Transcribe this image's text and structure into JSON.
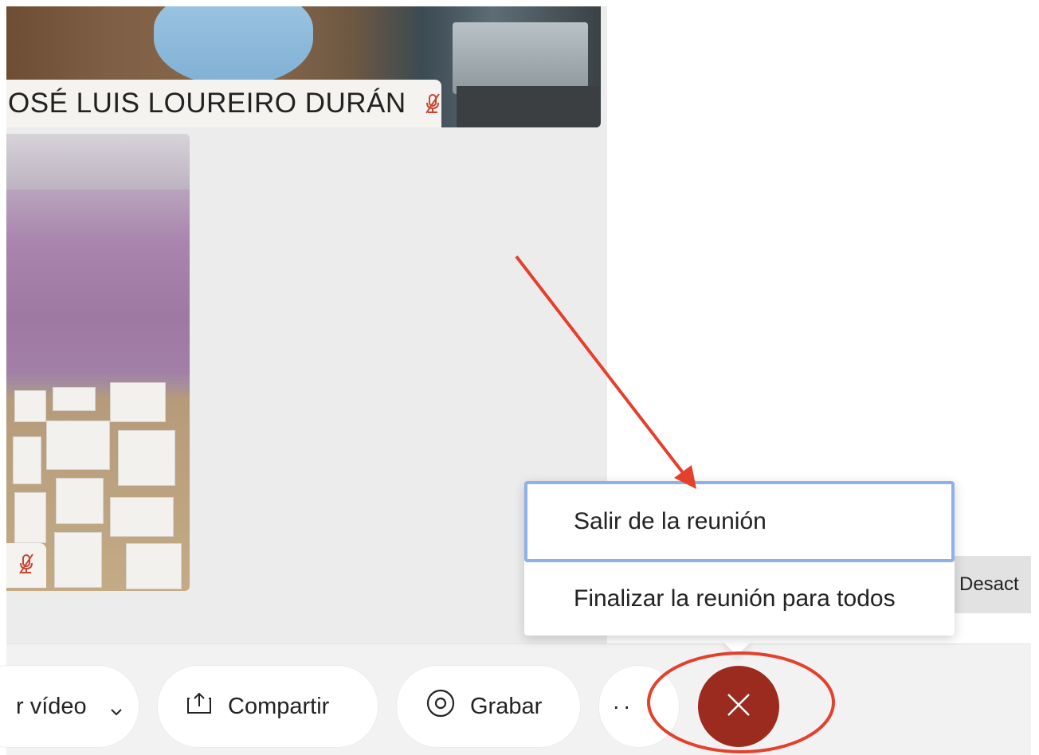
{
  "participants": {
    "top_name": "OSÉ LUIS LOUREIRO DURÁN"
  },
  "menu": {
    "leave_label": "Salir de la reunión",
    "end_all_label": "Finalizar la reunión para todos"
  },
  "side": {
    "desact_label": "Desact"
  },
  "toolbar": {
    "video_label": "r vídeo",
    "share_label": "Compartir",
    "record_label": "Grabar",
    "more_label": "··"
  },
  "icons": {
    "mic_off": "mic-off-icon",
    "chevron": "chevron-down-icon",
    "share": "share-upload-icon",
    "record": "record-icon",
    "end": "close-icon"
  },
  "colors": {
    "end_button": "#9a2b1e",
    "menu_highlight": "#8fb0ea",
    "annotation_red": "#e4402b",
    "mic_off_red": "#c8442f"
  }
}
